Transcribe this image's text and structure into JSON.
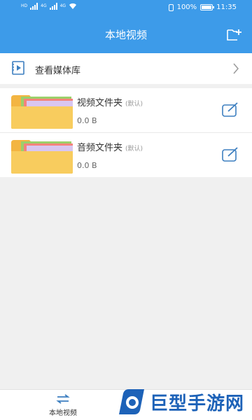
{
  "status_bar": {
    "net1": "HD",
    "net2": "4G",
    "net3": "4G",
    "battery": "100%",
    "time": "11:35"
  },
  "header": {
    "title": "本地视频",
    "action_icon": "add-folder-icon"
  },
  "media_library": {
    "label": "查看媒体库",
    "icon": "video-file-icon"
  },
  "folders": [
    {
      "name": "视频文件夹",
      "tag": "(默认)",
      "size": "0.0 B"
    },
    {
      "name": "音频文件夹",
      "tag": "(默认)",
      "size": "0.0 B"
    }
  ],
  "bottom_nav": {
    "tab_label": "本地视频"
  },
  "watermark": {
    "text": "巨型手游网"
  },
  "colors": {
    "primary": "#3d9be9",
    "folder": "#f6c451"
  }
}
